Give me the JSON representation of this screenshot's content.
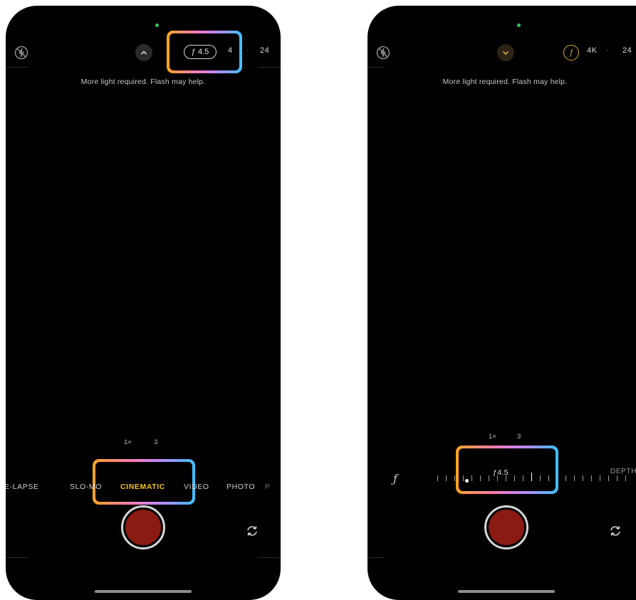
{
  "left_screen": {
    "warning": "More light required. Flash may help.",
    "aperture": "ƒ 4.5",
    "format_partial": "4",
    "separator": "·",
    "fps": "24",
    "zoom": [
      "1×",
      "3"
    ],
    "modes": {
      "timelapse": "E-LAPSE",
      "slomo": "SLO-MO",
      "cinematic": "CINEMATIC",
      "video": "VIDEO",
      "photo": "PHOTO",
      "extra": "P"
    }
  },
  "right_screen": {
    "warning": "More light required. Flash may help.",
    "aperture_icon": "ƒ",
    "format": "4K",
    "separator": "·",
    "fps": "24",
    "zoom": [
      "1×",
      "3"
    ],
    "depth_value": "ƒ4.5",
    "depth_symbol": "ƒ",
    "depth_label": "DEPTH"
  },
  "colors": {
    "active_mode": "#f3c21a",
    "aperture_accent": "#d9a93a",
    "shutter_red": "#8a1a12",
    "highlight_gradient": [
      "#ffa51f",
      "#ff7ab8",
      "#b68cff",
      "#3cc0ff"
    ]
  }
}
